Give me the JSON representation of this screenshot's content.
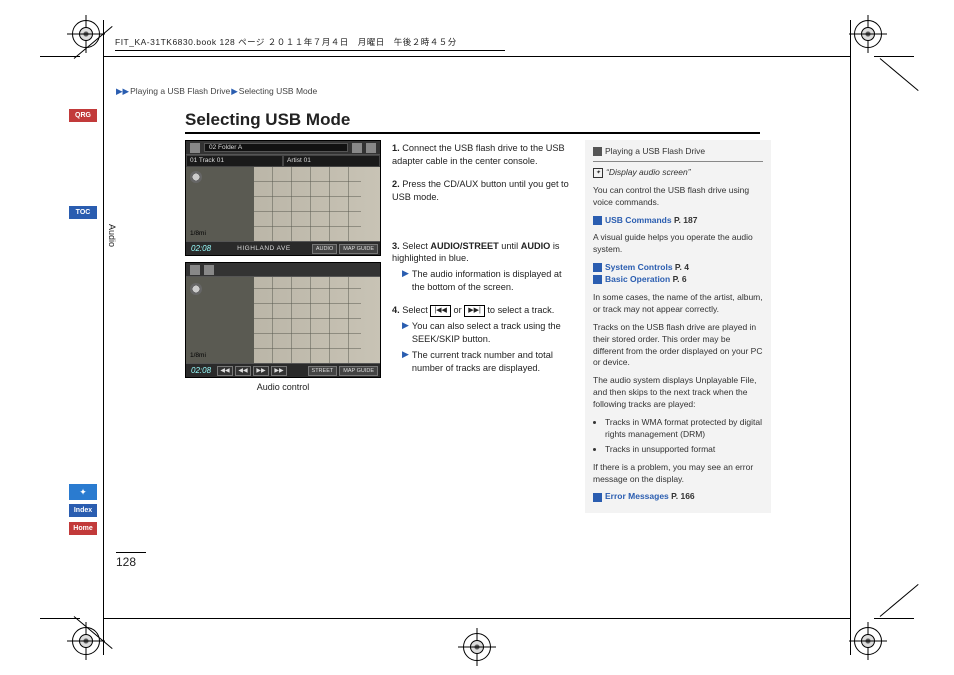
{
  "meta_header": "FIT_KA-31TK6830.book  128 ページ  ２０１１年７月４日　月曜日　午後２時４５分",
  "breadcrumb": {
    "sep1": "▶▶",
    "part1": "Playing a USB Flash Drive",
    "sep2": "▶",
    "part2": "Selecting USB Mode"
  },
  "title": "Selecting USB Mode",
  "tabs": {
    "qrg": "QRG",
    "toc": "TOC",
    "index": "Index",
    "home": "Home",
    "voice": "✦"
  },
  "section_label": "Audio",
  "page_number": "128",
  "screens": {
    "folder": "02 Folder A",
    "track_cell": "01 Track 01",
    "artist_cell": "Artist 01",
    "scale": "1/8mi",
    "clock": "02:08",
    "street": "HIGHLAND AVE",
    "btn_audio": "AUDIO",
    "btn_map": "MAP GUIDE",
    "prev2": "◀◀",
    "prev1": "◀◀",
    "next1": "▶▶",
    "next2": "▶▶",
    "btn_street": "STREET",
    "caption": "Audio control"
  },
  "instructions": {
    "s1_num": "1.",
    "s1": "Connect the USB flash drive to the USB adapter cable in the center console.",
    "s2_num": "2.",
    "s2": "Press the CD/AUX button until you get to USB mode.",
    "s3_num": "3.",
    "s3_pre": "Select ",
    "s3_bold1": "AUDIO/STREET",
    "s3_mid": " until ",
    "s3_bold2": "AUDIO",
    "s3_post": " is highlighted in blue.",
    "s3_sub": "The audio information is displayed at the bottom of the screen.",
    "s4_num": "4.",
    "s4_pre": "Select ",
    "s4_key1": "|◀◀",
    "s4_or": " or ",
    "s4_key2": "▶▶|",
    "s4_post": " to select a track.",
    "s4_sub1": "You can also select a track using the SEEK/SKIP button.",
    "s4_sub2": "The current track number and total number of tracks are displayed."
  },
  "notes": {
    "header": "Playing a USB Flash Drive",
    "voice_cmd": "“Display audio screen”",
    "p1": "You can control the USB flash drive using voice commands.",
    "link_usb": "USB Commands",
    "link_usb_p": "P. 187",
    "p2": "A visual guide helps you operate the audio system.",
    "link_sys": "System Controls",
    "link_sys_p": "P. 4",
    "link_basic": "Basic Operation",
    "link_basic_p": "P. 6",
    "p3": "In some cases, the name of the artist, album, or track may not appear correctly.",
    "p4": "Tracks on the USB flash drive are played in their stored order. This order may be different from the order displayed on your PC or device.",
    "p5": "The audio system displays Unplayable File, and then skips to the next track when the following tracks are played:",
    "b1": "Tracks in WMA format protected by digital rights management (DRM)",
    "b2": "Tracks in unsupported format",
    "p6": "If there is a problem, you may see an error message on the display.",
    "link_err": "Error Messages",
    "link_err_p": "P. 166"
  }
}
